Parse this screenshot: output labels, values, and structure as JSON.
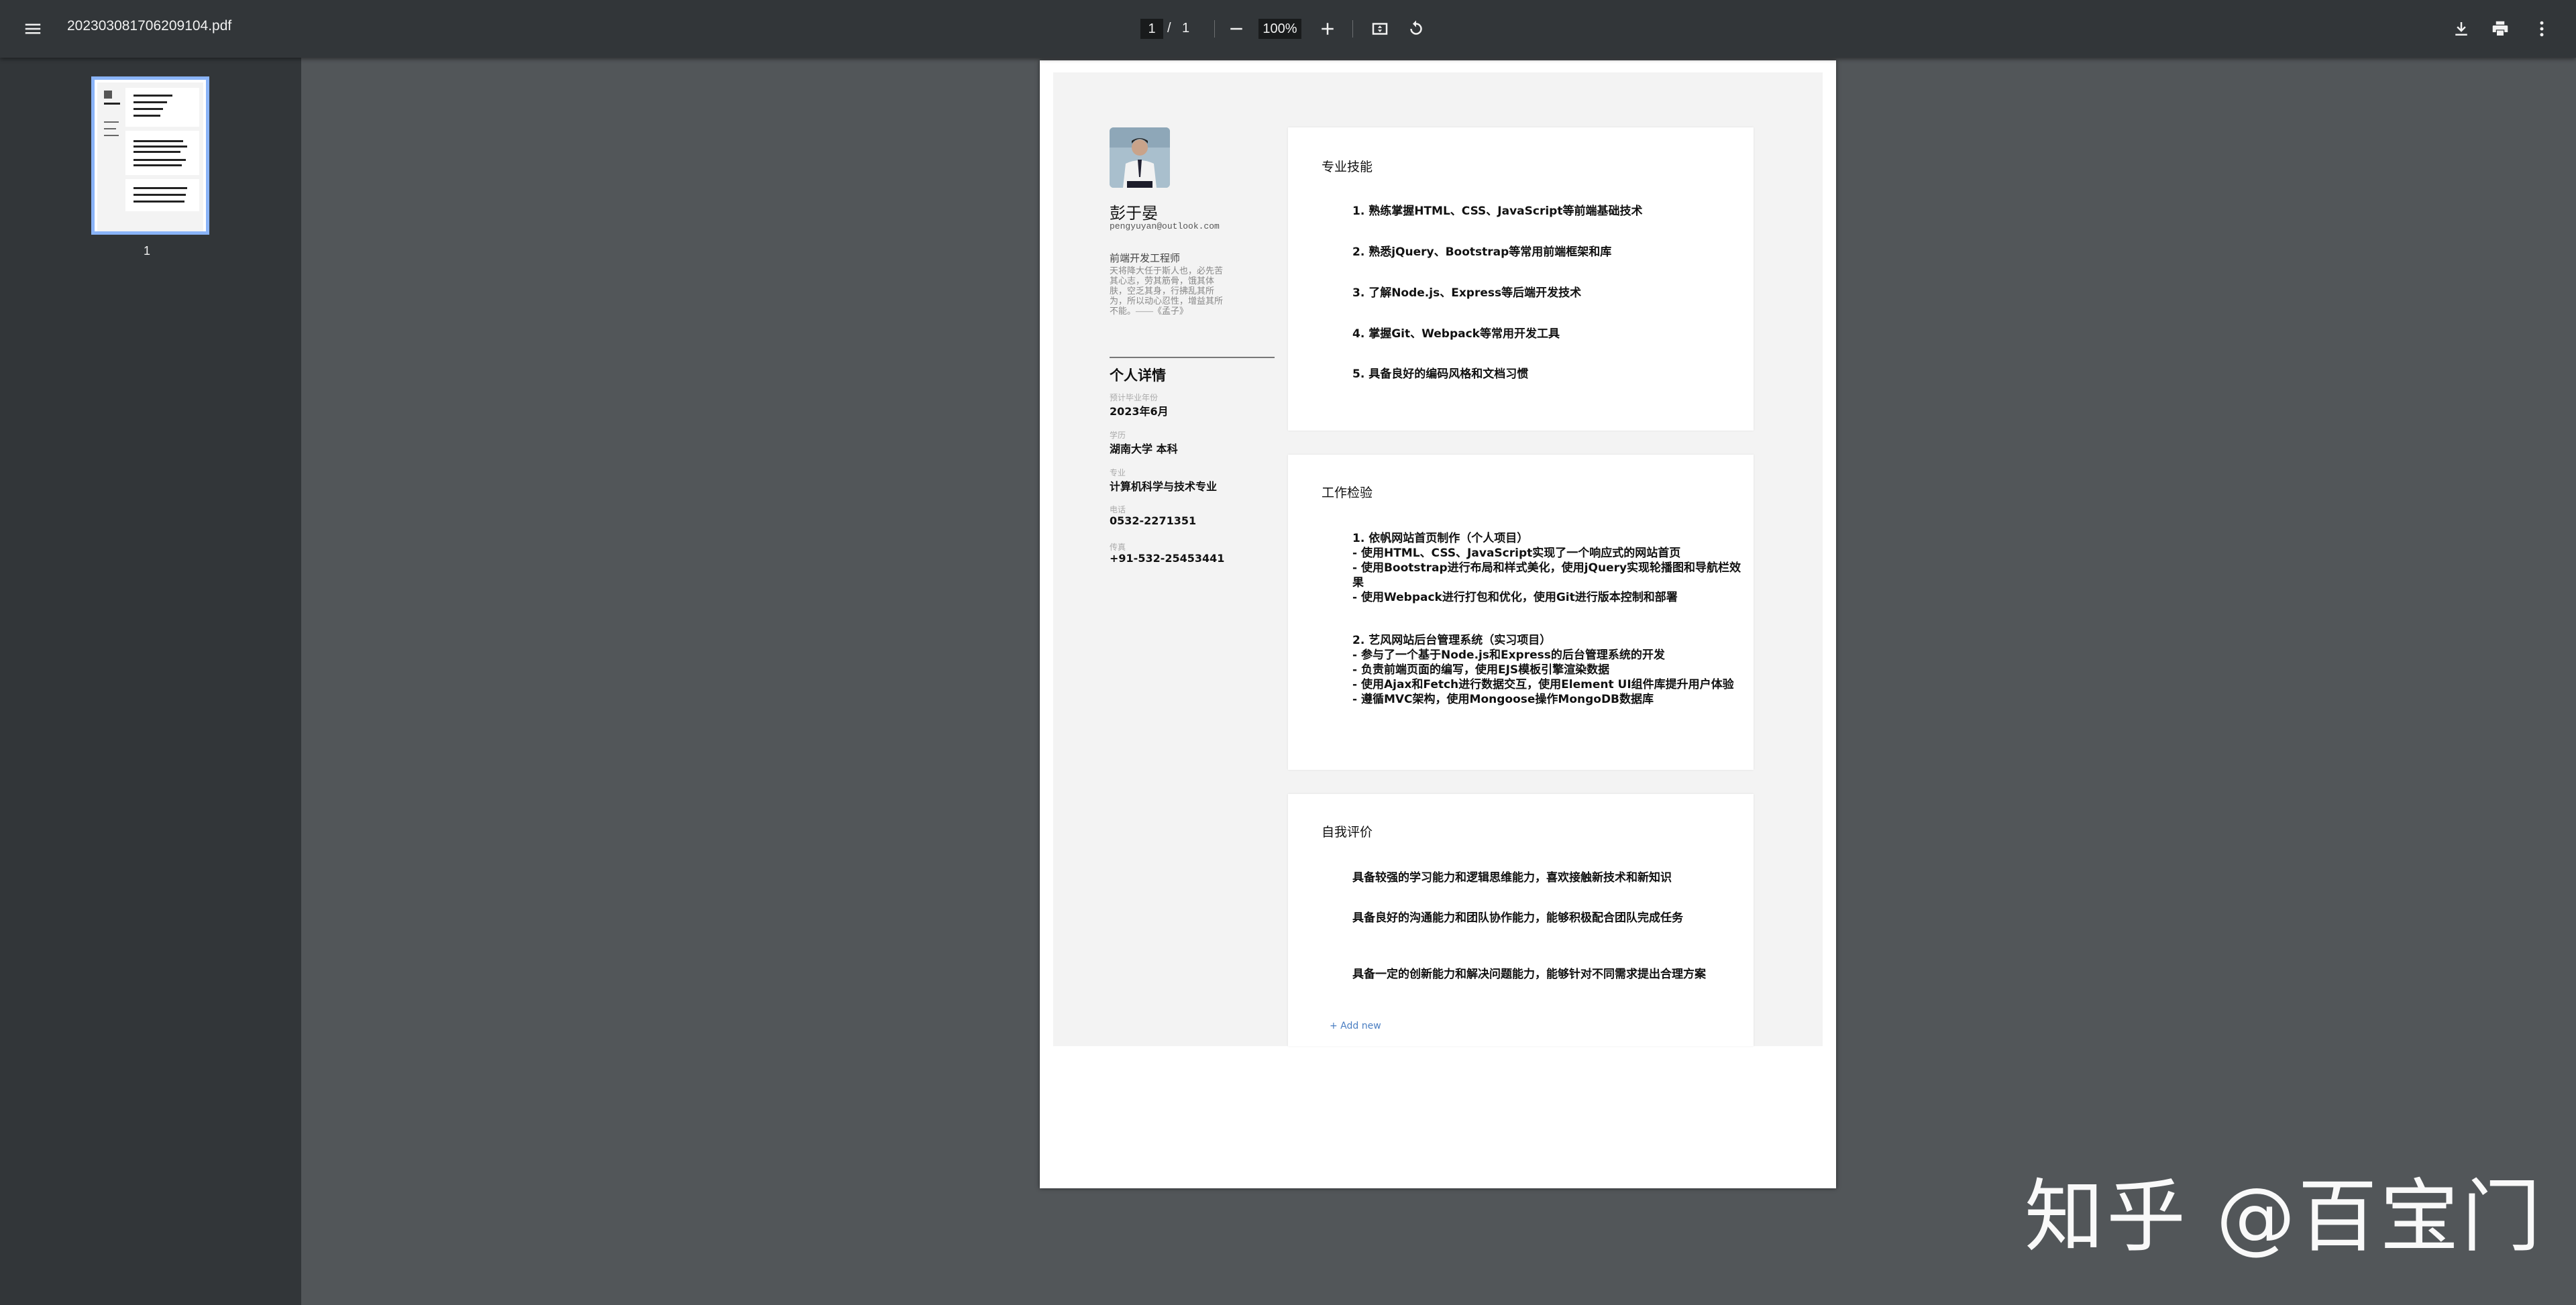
{
  "toolbar": {
    "title": "202303081706209104.pdf",
    "page_current": "1",
    "page_sep": "/",
    "page_total": "1",
    "zoom": "100%",
    "icons": [
      "menu-icon",
      "zoom-out-icon",
      "zoom-in-icon",
      "fit-page-icon",
      "rotate-icon",
      "download-icon",
      "print-icon",
      "more-vert-icon"
    ]
  },
  "sidebar": {
    "thumbnail_label": "1"
  },
  "resume": {
    "name": "彭于晏",
    "email": "pengyuyan@outlook.com",
    "role": "前端开发工程师",
    "quote": "天将降大任于斯人也，必先苦其心志，劳其筋骨，饿其体肤，空乏其身，行拂乱其所为，所以动心忍性，增益其所不能。——《孟子》",
    "details_title": "个人详情",
    "details": [
      {
        "label": "预计毕业年份",
        "value": "2023年6月"
      },
      {
        "label": "学历",
        "value": "湖南大学 本科"
      },
      {
        "label": "专业",
        "value": "计算机科学与技术专业"
      },
      {
        "label": "电话",
        "value": "0532-2271351"
      },
      {
        "label": "传真",
        "value": "+91-532-25453441"
      }
    ],
    "skills": {
      "title": "专业技能",
      "items": [
        "1. 熟练掌握HTML、CSS、JavaScript等前端基础技术",
        "2. 熟悉jQuery、Bootstrap等常用前端框架和库",
        "3. 了解Node.js、Express等后端开发技术",
        "4. 掌握Git、Webpack等常用开发工具",
        "5. 具备良好的编码风格和文档习惯"
      ]
    },
    "experience": {
      "title": "工作检验",
      "items": [
        "1. 依帆网站首页制作（个人项目）\n- 使用HTML、CSS、JavaScript实现了一个响应式的网站首页\n- 使用Bootstrap进行布局和样式美化，使用jQuery实现轮播图和导航栏效果\n- 使用Webpack进行打包和优化，使用Git进行版本控制和部署",
        "2. 艺风网站后台管理系统（实习项目）\n- 参与了一个基于Node.js和Express的后台管理系统的开发\n- 负责前端页面的编写，使用EJS模板引擎渲染数据\n- 使用Ajax和Fetch进行数据交互，使用Element UI组件库提升用户体验\n- 遵循MVC架构，使用Mongoose操作MongoDB数据库"
      ]
    },
    "self_eval": {
      "title": "自我评价",
      "items": [
        "具备较强的学习能力和逻辑思维能力，喜欢接触新技术和新知识",
        "具备良好的沟通能力和团队协作能力，能够积极配合团队完成任务",
        "具备一定的创新能力和解决问题能力，能够针对不同需求提出合理方案"
      ],
      "add_new": "+ Add new"
    }
  },
  "watermark": "知乎 @百宝门",
  "colors": {
    "toolbar_bg": "#323639",
    "viewer_bg": "#525659",
    "thumb_border": "#8ab4f8",
    "link": "#4a7ec2"
  }
}
